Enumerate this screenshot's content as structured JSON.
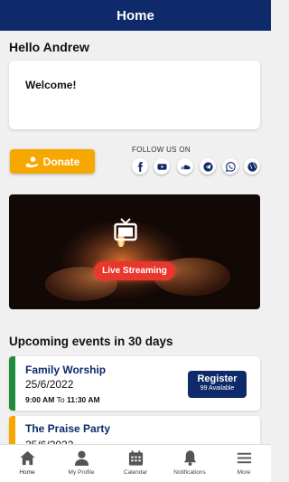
{
  "header": {
    "title": "Home"
  },
  "greeting": "Hello Andrew",
  "welcome_card": {
    "text": "Welcome!"
  },
  "donate": {
    "label": "Donate"
  },
  "follow": {
    "label": "FOLLOW US ON",
    "icons": [
      "facebook-icon",
      "youtube-icon",
      "soundcloud-icon",
      "telegram-icon",
      "whatsapp-icon",
      "globe-icon"
    ]
  },
  "live": {
    "label": "Live Streaming"
  },
  "events": {
    "title": "Upcoming events in 30 days",
    "items": [
      {
        "name": "Family Worship",
        "date": "25/6/2022",
        "time_start": "9:00 AM",
        "time_sep": "To",
        "time_end": "11:30 AM",
        "register_label": "Register",
        "availability": "99 Available",
        "accent": "#1e8c3a"
      },
      {
        "name": "The Praise Party",
        "date": "25/6/2022",
        "accent": "#f6a800"
      }
    ]
  },
  "bottom_nav": {
    "items": [
      {
        "label": "Home",
        "icon": "home-icon"
      },
      {
        "label": "My Profile",
        "icon": "profile-icon"
      },
      {
        "label": "Calendar",
        "icon": "calendar-icon"
      },
      {
        "label": "Notifications",
        "icon": "bell-icon"
      },
      {
        "label": "More",
        "icon": "menu-icon"
      }
    ]
  },
  "colors": {
    "brand": "#0e2a6a",
    "donate": "#f6a800",
    "live": "#e8372c"
  }
}
